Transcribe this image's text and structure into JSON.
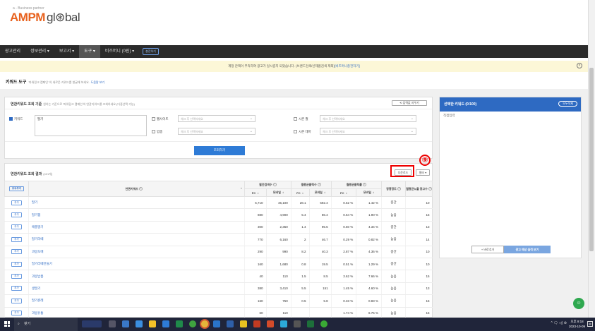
{
  "logo": {
    "tagline": "a - Business partner",
    "brand": "AMPM",
    "brand2": "gl⊛bal"
  },
  "nav": {
    "items": [
      "광고관리",
      "정보관리 ▾",
      "보고서 ▾",
      "도구 ▾",
      "비즈머니 (0원) ▾"
    ],
    "badge": "충전하기"
  },
  "notice": {
    "text": "계정 잔액이 부족하여 광고가 일시중지 되었습니다. (브랜드검색/신제품검색 제외)",
    "link": "[비즈머니충전하기]"
  },
  "page": {
    "title": "키워드 도구",
    "desc": "'파워링크 캠페인' 의 새로운 키워드를 발굴해 보세요.",
    "help": "도움말 보기"
  },
  "search": {
    "title": "연관키워드 조회 기준",
    "hint": "원하는 기준으로 '파워링크 캠페인'의 연관키워드를 조회하세요.(다중선택 가능)",
    "reset": "⟲ 입력값 지우기",
    "keyword_label": "키워드",
    "keyword_value": "딸기",
    "website": "웹사이트",
    "industry": "업종",
    "season_month": "시즌 월",
    "season_theme": "시즌 테마",
    "placeholder": "체크 후 선택하세요",
    "button": "조회하기"
  },
  "results": {
    "title": "연관키워드 조회 결과",
    "count": "(421개)",
    "download": "다운로드",
    "filter": "필터 ▾",
    "annotation": "⑨",
    "add_all": "모두추가",
    "col_keyword": "연관키워드",
    "col_search": "월간검색수",
    "col_clicks": "월평균클릭수",
    "col_ctr": "월평균클릭률",
    "col_comp": "경쟁정도",
    "col_ads": "월평균노출 광고수",
    "pc": "PC",
    "mobile": "모바일",
    "add_label": "추가",
    "rows": [
      [
        "딸기",
        "5,710",
        "45,100",
        "28.1",
        "592.4",
        "0.52 %",
        "1.42 %",
        "중간",
        "10"
      ],
      [
        "딸기잼",
        "880",
        "4,900",
        "5.4",
        "86.4",
        "0.64 %",
        "1.90 %",
        "높음",
        "15"
      ],
      [
        "애플딸기",
        "300",
        "2,350",
        "1.4",
        "95.5",
        "0.50 %",
        "4.34 %",
        "중간",
        "13"
      ],
      [
        "딸기라떼",
        "770",
        "6,160",
        "2",
        "46.7",
        "0.29 %",
        "0.82 %",
        "높음",
        "14"
      ],
      [
        "과일도매",
        "290",
        "990",
        "8.2",
        "40.3",
        "2.87 %",
        "4.36 %",
        "중간",
        "10"
      ],
      [
        "딸기라떼만들기",
        "160",
        "1,680",
        "0.8",
        "19.5",
        "0.51 %",
        "1.29 %",
        "중간",
        "10"
      ],
      [
        "과일납품",
        "40",
        "110",
        "1.5",
        "8.5",
        "3.62 %",
        "7.66 %",
        "높음",
        "15"
      ],
      [
        "생딸기",
        "380",
        "3,410",
        "5.5",
        "151",
        "1.45 %",
        "4.60 %",
        "높음",
        "13"
      ],
      [
        "딸기존레",
        "160",
        "750",
        "0.5",
        "5.8",
        "0.33 %",
        "0.83 %",
        "높음",
        "15"
      ],
      [
        "과일유통",
        "60",
        "110",
        "",
        "",
        "1.74 %",
        "6.75 %",
        "높음",
        "15"
      ]
    ]
  },
  "selected": {
    "title": "선택한 키워드 (0/100)",
    "clear": "모두삭제",
    "direct": "직접입력",
    "add_btn": "+ 바로추가",
    "check_btn": "광고 예상 실적 보기"
  },
  "taskbar": {
    "search": "찾기",
    "tray": "^ 🗨 ◁) ⊕",
    "time": "오후 9:18",
    "date": "2023-10-09"
  }
}
